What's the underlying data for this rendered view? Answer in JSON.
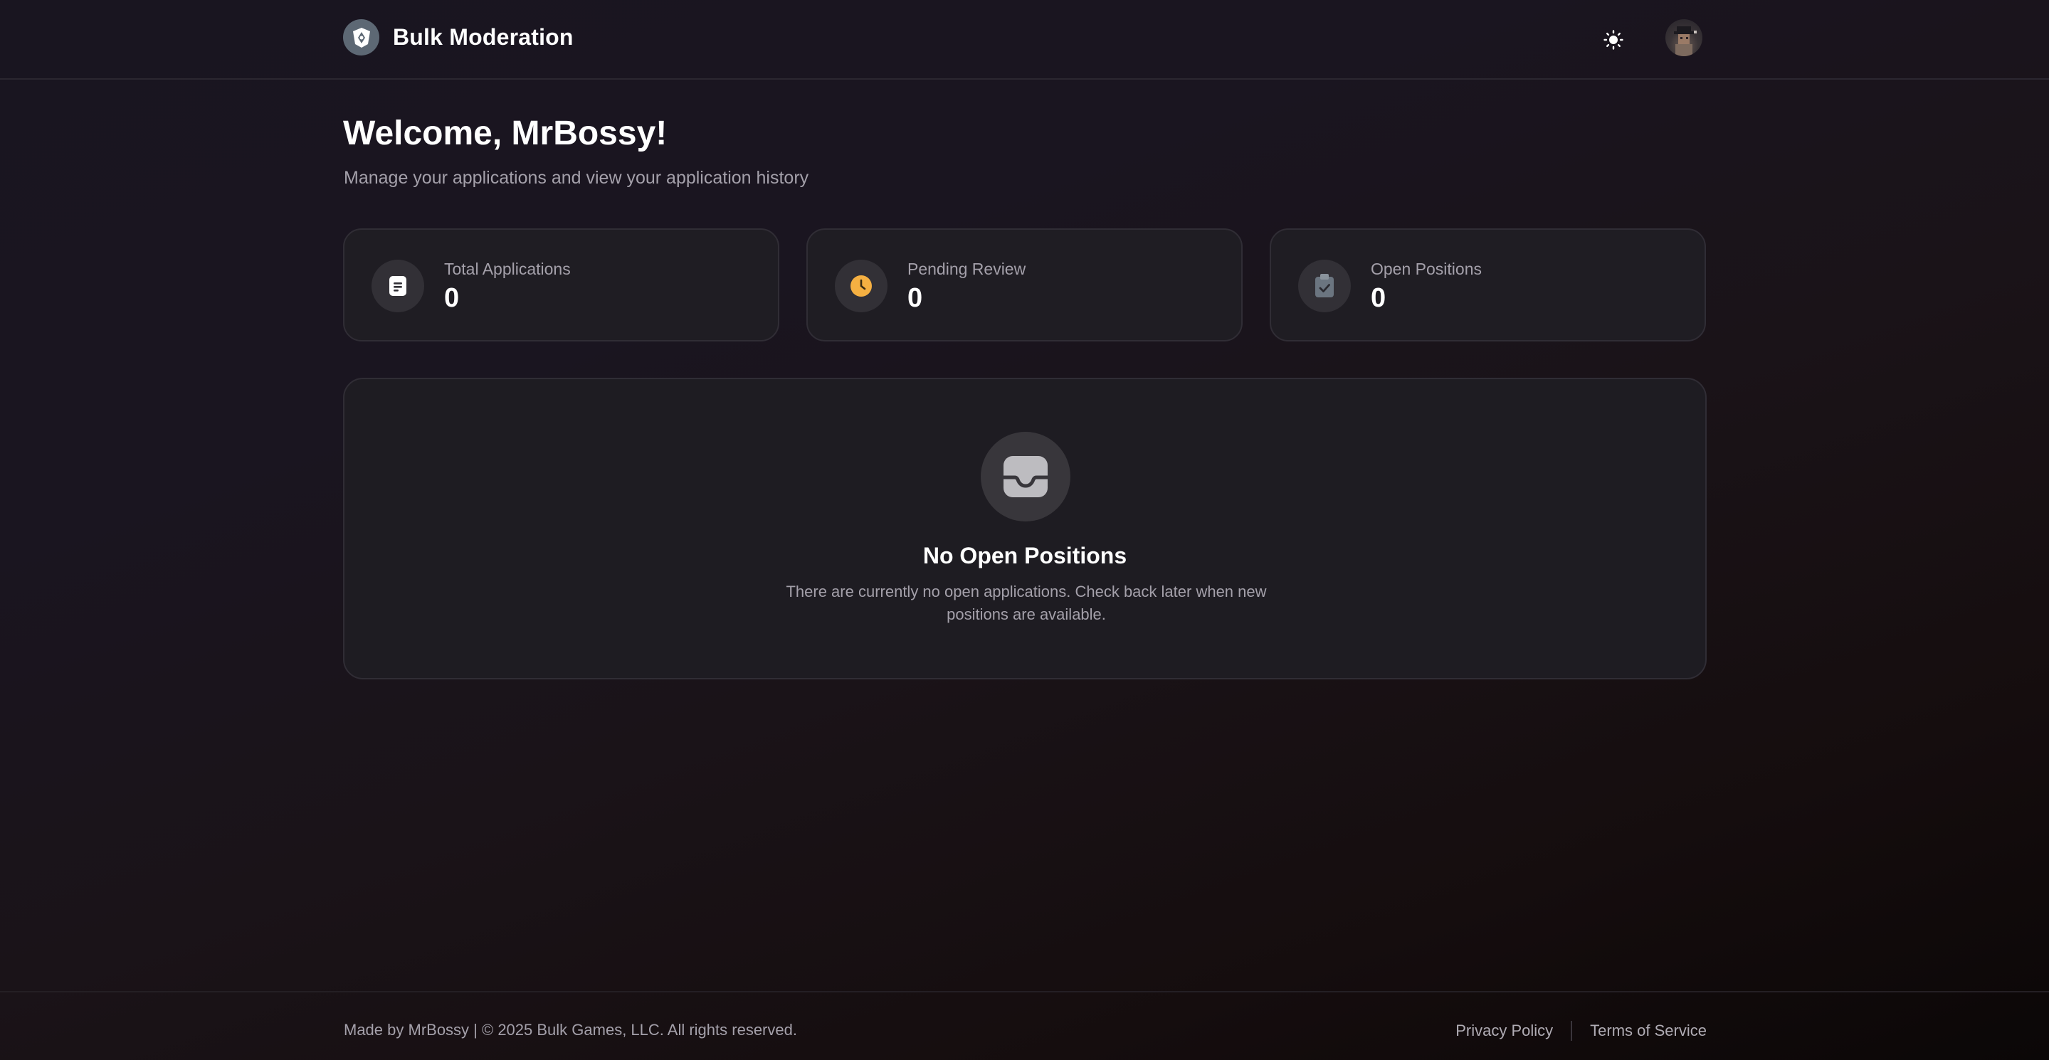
{
  "header": {
    "brand_title": "Bulk Moderation",
    "logo_icon": "shield-logo-icon",
    "theme_toggle_icon": "sun-icon",
    "avatar_icon": "user-avatar"
  },
  "welcome": {
    "title": "Welcome, MrBossy!",
    "subtitle": "Manage your applications and view your application history"
  },
  "stats": [
    {
      "label": "Total Applications",
      "value": "0",
      "icon": "document-icon",
      "icon_color": "#ffffff"
    },
    {
      "label": "Pending Review",
      "value": "0",
      "icon": "clock-icon",
      "icon_color": "#f5b042"
    },
    {
      "label": "Open Positions",
      "value": "0",
      "icon": "clipboard-check-icon",
      "icon_color": "#6b7580"
    }
  ],
  "empty_state": {
    "icon": "inbox-icon",
    "title": "No Open Positions",
    "description": "There are currently no open applications. Check back later when new positions are available."
  },
  "footer": {
    "copyright": "Made by MrBossy | © 2025 Bulk Games, LLC. All rights reserved.",
    "links": [
      "Privacy Policy",
      "Terms of Service"
    ]
  },
  "colors": {
    "background_top": "#191520",
    "card_bg": "#1f1d23",
    "card_border": "#302d35",
    "muted_text": "#a4a0aa",
    "accent_pending": "#f5b042"
  }
}
